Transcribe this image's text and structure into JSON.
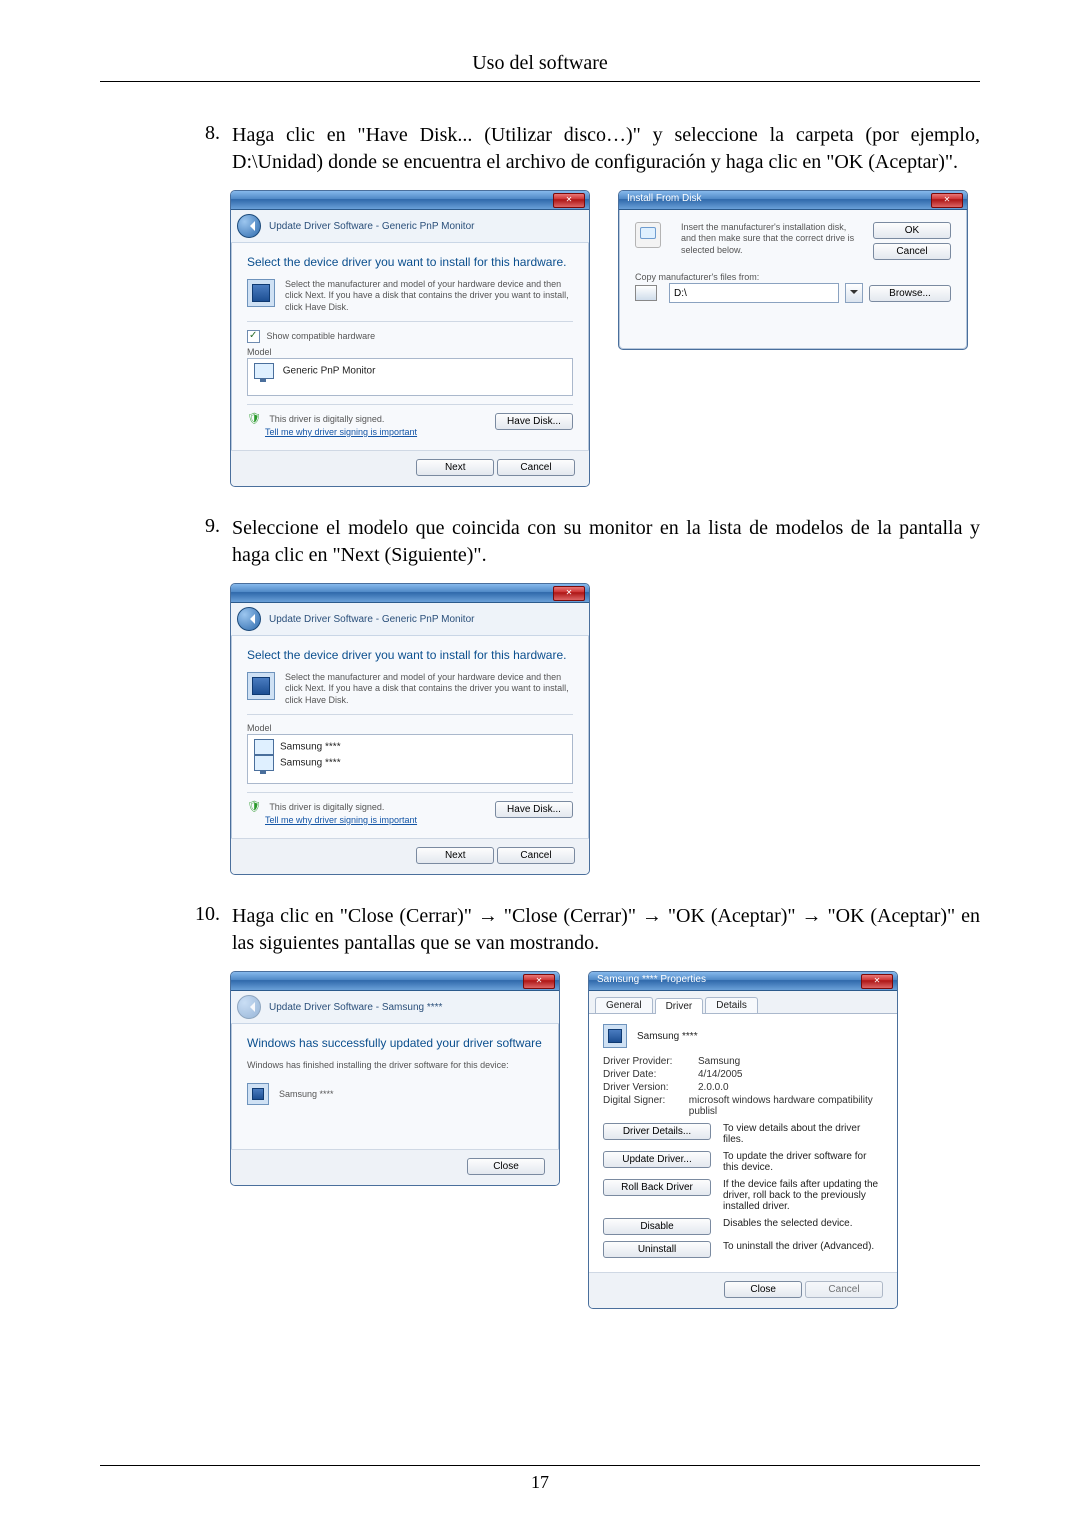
{
  "header": {
    "title": "Uso del software"
  },
  "steps": {
    "s8": {
      "num": "8.",
      "text": "Haga clic en \"Have Disk... (Utilizar disco…)\" y seleccione la carpeta (por ejemplo, D:\\Unidad) donde se encuentra el archivo de configuración y haga clic en \"OK (Aceptar)\"."
    },
    "s9": {
      "num": "9.",
      "text": "Seleccione el modelo que coincida con su monitor en la lista de modelos de la pantalla y haga clic en \"Next (Siguiente)\"."
    },
    "s10": {
      "num": "10.",
      "text": "Haga clic en \"Close (Cerrar)\" → \"Close (Cerrar)\" → \"OK (Aceptar)\" → \"OK (Aceptar)\" en las siguientes pantallas que se van mostrando."
    }
  },
  "driverWizard": {
    "breadcrumb": "Update Driver Software - Generic PnP Monitor",
    "heading": "Select the device driver you want to install for this hardware.",
    "subtext": "Select the manufacturer and model of your hardware device and then click Next. If you have a disk that contains the driver you want to install, click Have Disk.",
    "show_compat": "Show compatible hardware",
    "model_label": "Model",
    "model_item": "Generic PnP Monitor",
    "signed": "This driver is digitally signed.",
    "tell_me": "Tell me why driver signing is important",
    "have_disk": "Have Disk...",
    "next": "Next",
    "cancel": "Cancel"
  },
  "installDisk": {
    "title": "Install From Disk",
    "instruction": "Insert the manufacturer's installation disk, and then make sure that the correct drive is selected below.",
    "ok": "OK",
    "cancel": "Cancel",
    "copy_from": "Copy manufacturer's files from:",
    "path": "D:\\",
    "browse": "Browse..."
  },
  "driverWizard2": {
    "breadcrumb": "Update Driver Software - Generic PnP Monitor",
    "heading": "Select the device driver you want to install for this hardware.",
    "subtext": "Select the manufacturer and model of your hardware device and then click Next. If you have a disk that contains the driver you want to install, click Have Disk.",
    "model_label": "Model",
    "model_item1": "Samsung ****",
    "model_item2": "Samsung ****",
    "signed": "This driver is digitally signed.",
    "tell_me": "Tell me why driver signing is important",
    "have_disk": "Have Disk...",
    "next": "Next",
    "cancel": "Cancel"
  },
  "success": {
    "breadcrumb": "Update Driver Software - Samsung ****",
    "heading": "Windows has successfully updated your driver software",
    "subtext": "Windows has finished installing the driver software for this device:",
    "device": "Samsung ****",
    "close": "Close"
  },
  "properties": {
    "title": "Samsung **** Properties",
    "tab_general": "General",
    "tab_driver": "Driver",
    "tab_details": "Details",
    "device": "Samsung ****",
    "provider_k": "Driver Provider:",
    "provider_v": "Samsung",
    "date_k": "Driver Date:",
    "date_v": "4/14/2005",
    "version_k": "Driver Version:",
    "version_v": "2.0.0.0",
    "signer_k": "Digital Signer:",
    "signer_v": "microsoft windows hardware compatibility publisl",
    "btn_details": "Driver Details...",
    "btn_details_desc": "To view details about the driver files.",
    "btn_update": "Update Driver...",
    "btn_update_desc": "To update the driver software for this device.",
    "btn_rollback": "Roll Back Driver",
    "btn_rollback_desc": "If the device fails after updating the driver, roll back to the previously installed driver.",
    "btn_disable": "Disable",
    "btn_disable_desc": "Disables the selected device.",
    "btn_uninstall": "Uninstall",
    "btn_uninstall_desc": "To uninstall the driver (Advanced).",
    "close": "Close",
    "cancel": "Cancel"
  },
  "footer": {
    "page": "17"
  }
}
